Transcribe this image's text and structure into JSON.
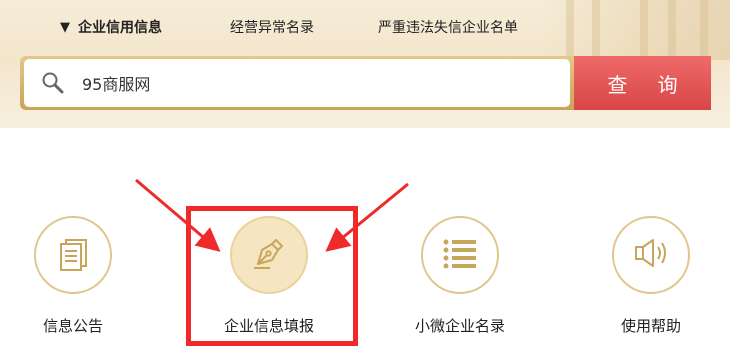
{
  "nav": {
    "tabs": [
      {
        "label": "企业信用信息",
        "active": true
      },
      {
        "label": "经营异常名录",
        "active": false
      },
      {
        "label": "严重违法失信企业名单",
        "active": false
      }
    ]
  },
  "search": {
    "value": "95商服网",
    "button_label": "查 询"
  },
  "menu": [
    {
      "label": "信息公告",
      "icon": "document-icon"
    },
    {
      "label": "企业信息填报",
      "icon": "pen-icon",
      "highlighted": true
    },
    {
      "label": "小微企业名录",
      "icon": "list-icon"
    },
    {
      "label": "使用帮助",
      "icon": "speaker-icon"
    }
  ],
  "colors": {
    "accent_gold": "#d9bb7a",
    "search_button": "#e45353",
    "highlight_red": "#ee2a2a"
  }
}
